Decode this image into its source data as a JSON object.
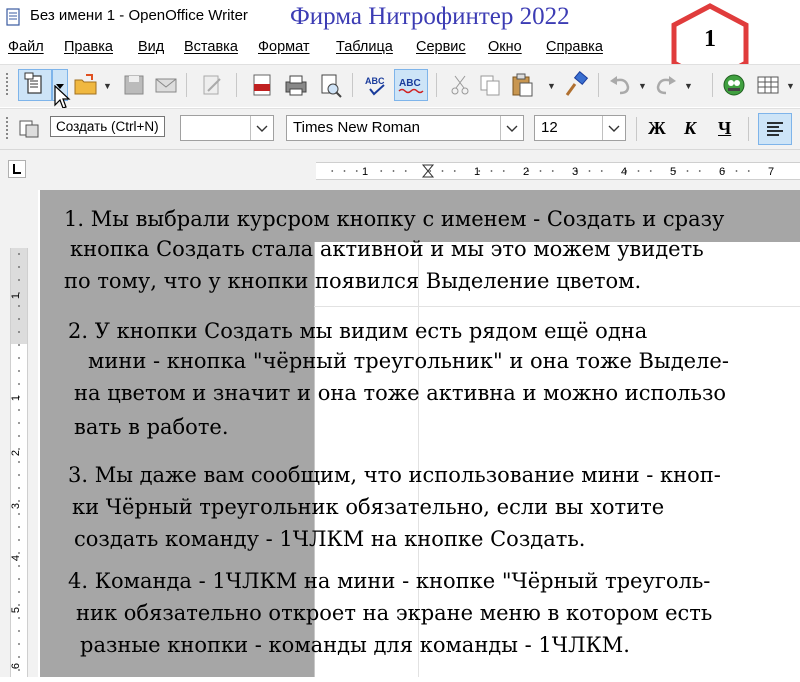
{
  "window": {
    "title": "Без имени 1 - OpenOffice Writer",
    "overlay_caption": "Фирма Нитрофинтер 2022"
  },
  "badge": {
    "number": "1",
    "color": "#e03c3c"
  },
  "menu": [
    "Файл",
    "Правка",
    "Вид",
    "Вставка",
    "Формат",
    "Таблица",
    "Сервис",
    "Окно",
    "Справка"
  ],
  "toolbar": {
    "icons": [
      "new-icon",
      "open-icon",
      "save-icon",
      "email-icon",
      "edit-doc-icon",
      "pdf-icon",
      "print-icon",
      "preview-icon",
      "spellcheck-icon",
      "autospell-icon",
      "cut-icon",
      "copy-icon",
      "paste-icon",
      "clone-format-icon",
      "undo-icon",
      "redo-icon",
      "navigator-icon",
      "table-icon"
    ]
  },
  "formatting": {
    "font_name": "Times New Roman",
    "font_size": "12",
    "bold": "Ж",
    "italic": "К",
    "underline": "Ч"
  },
  "tooltip": "Создать (Ctrl+N)",
  "ruler": {
    "h_marks": [
      "1",
      "1",
      "2",
      "3",
      "4",
      "5",
      "6",
      "7"
    ],
    "v_marks": [
      "1",
      "1",
      "2",
      "3",
      "4",
      "5",
      "6"
    ]
  },
  "document": {
    "lines": [
      "1. Мы выбрали курсром кнопку с именем - Создать и сразу",
      "кнопка Создать стала активной и мы это можем увидеть",
      "по тому, что у кнопки появился Выделение цветом.",
      "2. У кнопки Создать мы видим есть рядом ещё одна",
      "мини - кнопка \"чёрный треугольник\" и она тоже Выделе-",
      "на цветом и значит и она тоже активна и можно использо",
      "вать в работе.",
      "3. Мы даже вам сообщим, что использование мини - кноп-",
      "ки Чёрный треугольник обязательно, если вы хотите",
      "создать команду -     1ЧЛКМ на кнопке Создать.",
      "4. Команда - 1ЧЛКМ на мини - кнопке \"Чёрный треуголь-",
      "ник обязательно откроет на экране меню в котором есть",
      "разные кнопки - команды      для команды - 1ЧЛКМ."
    ]
  },
  "colors": {
    "caption": "#3c3cb4",
    "highlight": "#cde4f7",
    "page_gray": "#a6a6a6"
  }
}
